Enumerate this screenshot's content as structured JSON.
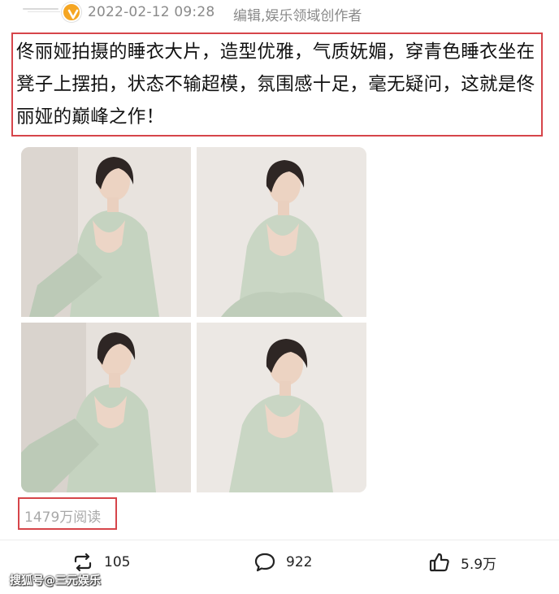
{
  "post": {
    "timestamp": "2022-02-12 09:28",
    "source": "编辑,娱乐领域创作者",
    "text": "佟丽娅拍摄的睡衣大片，造型优雅，气质妩媚，穿青色睡衣坐在凳子上摆拍，状态不输超模，氛围感十足，毫无疑问，这就是佟丽娅的巅峰之作！",
    "read_count": "1479万阅读"
  },
  "actions": {
    "repost_count": "105",
    "comment_count": "922",
    "like_count": "5.9万"
  },
  "watermark": "搜狐号@三元娱乐",
  "colors": {
    "highlight_border": "#d6454a",
    "verified_badge": "#f5a623",
    "meta_text": "#8a8a8a",
    "photo_background": "#e9e5e1",
    "pajama": "#c5d3c0"
  },
  "icons": {
    "verified": "verified-badge-icon",
    "repost": "repost-icon",
    "comment": "comment-icon",
    "like": "thumbs-up-icon"
  }
}
